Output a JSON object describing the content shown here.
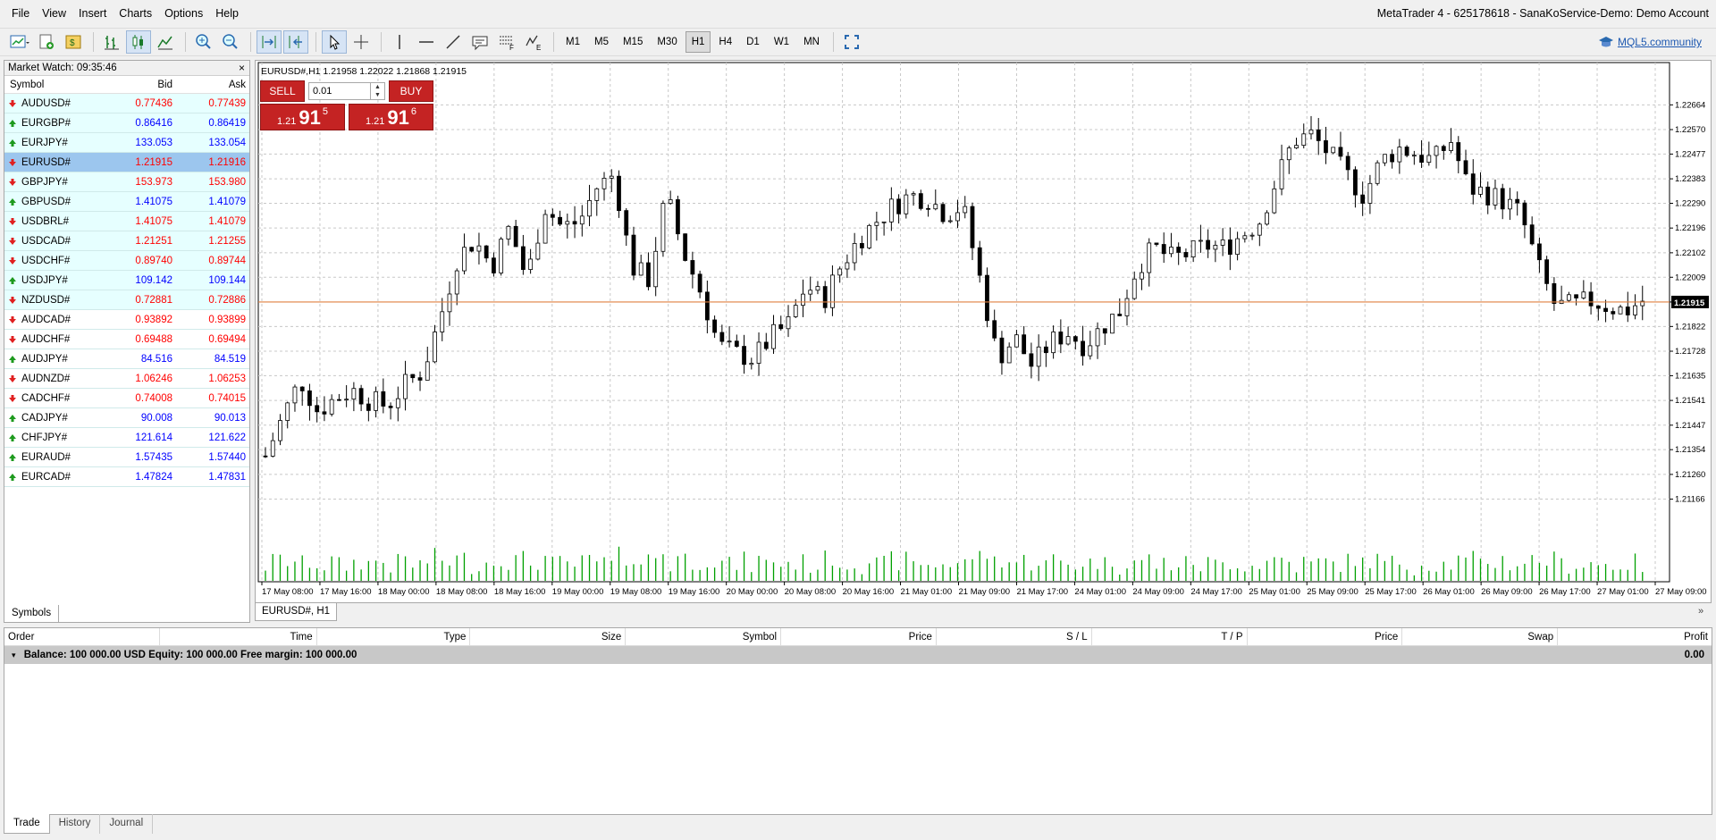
{
  "menu": [
    "File",
    "View",
    "Insert",
    "Charts",
    "Options",
    "Help"
  ],
  "window_title": "MetaTrader 4 - 625178618 - SanaKoService-Demo: Demo Account",
  "toolbar": {
    "timeframes": [
      "M1",
      "M5",
      "M15",
      "M30",
      "H1",
      "H4",
      "D1",
      "W1",
      "MN"
    ],
    "active_timeframe": "H1",
    "mql_link": "MQL5.community"
  },
  "market_watch": {
    "title": "Market Watch: 09:35:46",
    "close": "×",
    "columns": [
      "Symbol",
      "Bid",
      "Ask"
    ],
    "rows": [
      {
        "symbol": "AUDUSD#",
        "bid": "0.77436",
        "ask": "0.77439",
        "dir": "down",
        "hl": true
      },
      {
        "symbol": "EURGBP#",
        "bid": "0.86416",
        "ask": "0.86419",
        "dir": "up",
        "hl": true
      },
      {
        "symbol": "EURJPY#",
        "bid": "133.053",
        "ask": "133.054",
        "dir": "up",
        "hl": true
      },
      {
        "symbol": "EURUSD#",
        "bid": "1.21915",
        "ask": "1.21916",
        "dir": "down",
        "hl": true,
        "selected": true
      },
      {
        "symbol": "GBPJPY#",
        "bid": "153.973",
        "ask": "153.980",
        "dir": "down",
        "hl": true
      },
      {
        "symbol": "GBPUSD#",
        "bid": "1.41075",
        "ask": "1.41079",
        "dir": "up",
        "hl": true
      },
      {
        "symbol": "USDBRL#",
        "bid": "1.41075",
        "ask": "1.41079",
        "dir": "down",
        "hl": true
      },
      {
        "symbol": "USDCAD#",
        "bid": "1.21251",
        "ask": "1.21255",
        "dir": "down",
        "hl": true
      },
      {
        "symbol": "USDCHF#",
        "bid": "0.89740",
        "ask": "0.89744",
        "dir": "down",
        "hl": true
      },
      {
        "symbol": "USDJPY#",
        "bid": "109.142",
        "ask": "109.144",
        "dir": "up",
        "hl": true
      },
      {
        "symbol": "NZDUSD#",
        "bid": "0.72881",
        "ask": "0.72886",
        "dir": "down",
        "hl": true
      },
      {
        "symbol": "AUDCAD#",
        "bid": "0.93892",
        "ask": "0.93899",
        "dir": "down",
        "hl": false
      },
      {
        "symbol": "AUDCHF#",
        "bid": "0.69488",
        "ask": "0.69494",
        "dir": "down",
        "hl": false
      },
      {
        "symbol": "AUDJPY#",
        "bid": "84.516",
        "ask": "84.519",
        "dir": "up",
        "hl": false
      },
      {
        "symbol": "AUDNZD#",
        "bid": "1.06246",
        "ask": "1.06253",
        "dir": "down",
        "hl": false
      },
      {
        "symbol": "CADCHF#",
        "bid": "0.74008",
        "ask": "0.74015",
        "dir": "down",
        "hl": false
      },
      {
        "symbol": "CADJPY#",
        "bid": "90.008",
        "ask": "90.013",
        "dir": "up",
        "hl": false
      },
      {
        "symbol": "CHFJPY#",
        "bid": "121.614",
        "ask": "121.622",
        "dir": "up",
        "hl": false
      },
      {
        "symbol": "EURAUD#",
        "bid": "1.57435",
        "ask": "1.57440",
        "dir": "up",
        "hl": false
      },
      {
        "symbol": "EURCAD#",
        "bid": "1.47824",
        "ask": "1.47831",
        "dir": "up",
        "hl": false
      }
    ],
    "tab": "Symbols"
  },
  "chart": {
    "title": "EURUSD#,H1  1.21958 1.22022 1.21868 1.21915",
    "tab": "EURUSD#, H1",
    "one_click": {
      "sell": "SELL",
      "buy": "BUY",
      "lot": "0.01",
      "sell_price_small": "1.21",
      "sell_price_big": "91",
      "sell_price_sup": "5",
      "buy_price_small": "1.21",
      "buy_price_big": "91",
      "buy_price_sup": "6"
    }
  },
  "chart_data": {
    "type": "candlestick",
    "symbol": "EURUSD#",
    "timeframe": "H1",
    "ylim": [
      1.211,
      1.2275
    ],
    "y_ticks": [
      "1.22664",
      "1.22570",
      "1.22477",
      "1.22383",
      "1.22290",
      "1.22196",
      "1.22102",
      "1.22009",
      "1.21915",
      "1.21822",
      "1.21728",
      "1.21635",
      "1.21541",
      "1.21447",
      "1.21354",
      "1.21260",
      "1.21166"
    ],
    "current_price": "1.21915",
    "x_ticks": [
      "17 May 08:00",
      "17 May 16:00",
      "18 May 00:00",
      "18 May 08:00",
      "18 May 16:00",
      "19 May 00:00",
      "19 May 08:00",
      "19 May 16:00",
      "20 May 00:00",
      "20 May 08:00",
      "20 May 16:00",
      "21 May 01:00",
      "21 May 09:00",
      "21 May 17:00",
      "24 May 01:00",
      "24 May 09:00",
      "24 May 17:00",
      "25 May 01:00",
      "25 May 09:00",
      "25 May 17:00",
      "26 May 01:00",
      "26 May 09:00",
      "26 May 17:00",
      "27 May 01:00",
      "27 May 09:00"
    ],
    "close_path": [
      1.2133,
      1.2148,
      1.2162,
      1.215,
      1.2155,
      1.2158,
      1.2154,
      1.2152,
      1.216,
      1.2165,
      1.2185,
      1.2208,
      1.2215,
      1.2205,
      1.222,
      1.22,
      1.2228,
      1.222,
      1.2222,
      1.2235,
      1.224,
      1.2205,
      1.22,
      1.2232,
      1.221,
      1.2195,
      1.2175,
      1.2172,
      1.217,
      1.2178,
      1.2183,
      1.2198,
      1.2192,
      1.2205,
      1.2215,
      1.2222,
      1.2228,
      1.2232,
      1.2231,
      1.2225,
      1.2228,
      1.22,
      1.217,
      1.2178,
      1.2167,
      1.2176,
      1.218,
      1.2175,
      1.2182,
      1.2188,
      1.2205,
      1.2212,
      1.2208,
      1.221,
      1.2213,
      1.2212,
      1.2217,
      1.2222,
      1.2238,
      1.2253,
      1.2255,
      1.2248,
      1.224,
      1.2232,
      1.2245,
      1.225,
      1.2248,
      1.2245,
      1.2253,
      1.2235,
      1.2233,
      1.223,
      1.2225,
      1.2205,
      1.219,
      1.219,
      1.2192,
      1.219,
      1.2188,
      1.2192
    ],
    "volume_color": "#00a000",
    "price_line_color": "#e08040"
  },
  "terminal": {
    "columns": [
      "Order",
      "Time",
      "Type",
      "Size",
      "Symbol",
      "Price",
      "S / L",
      "T / P",
      "Price",
      "Swap",
      "Profit"
    ],
    "balance_text": "Balance: 100 000.00 USD  Equity: 100 000.00  Free margin: 100 000.00",
    "profit": "0.00",
    "tabs": [
      "Trade",
      "History",
      "Journal"
    ]
  }
}
